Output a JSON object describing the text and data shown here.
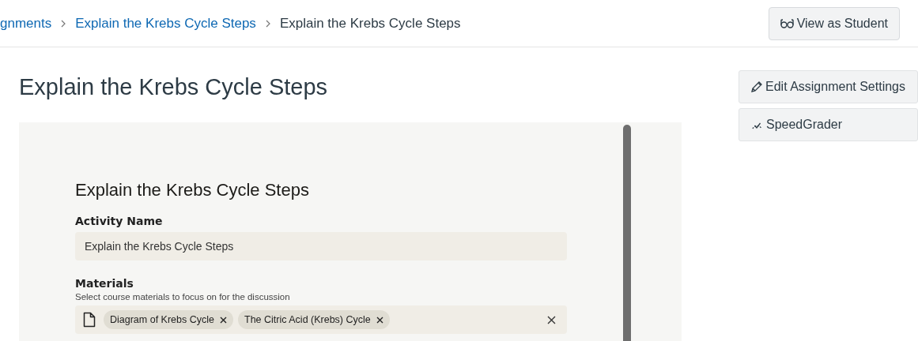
{
  "breadcrumbs": [
    {
      "label": "gnments",
      "link": true
    },
    {
      "label": "Explain the Krebs Cycle Steps",
      "link": true
    },
    {
      "label": "Explain the Krebs Cycle Steps",
      "link": false
    }
  ],
  "header_button": "View as Student",
  "title": "Explain the Krebs Cycle Steps",
  "side_buttons": [
    {
      "label": "Edit Assignment Settings",
      "kind": "edit"
    },
    {
      "label": "SpeedGrader",
      "kind": "grader"
    }
  ],
  "embed": {
    "heading": "Explain the Krebs Cycle Steps",
    "activity_label": "Activity Name",
    "activity_value": "Explain the Krebs Cycle Steps",
    "materials_label": "Materials",
    "materials_hint": "Select course materials to focus on for the discussion",
    "chips": [
      {
        "label": "Diagram of Krebs Cycle"
      },
      {
        "label": "The Citric Acid (Krebs) Cycle"
      }
    ]
  }
}
